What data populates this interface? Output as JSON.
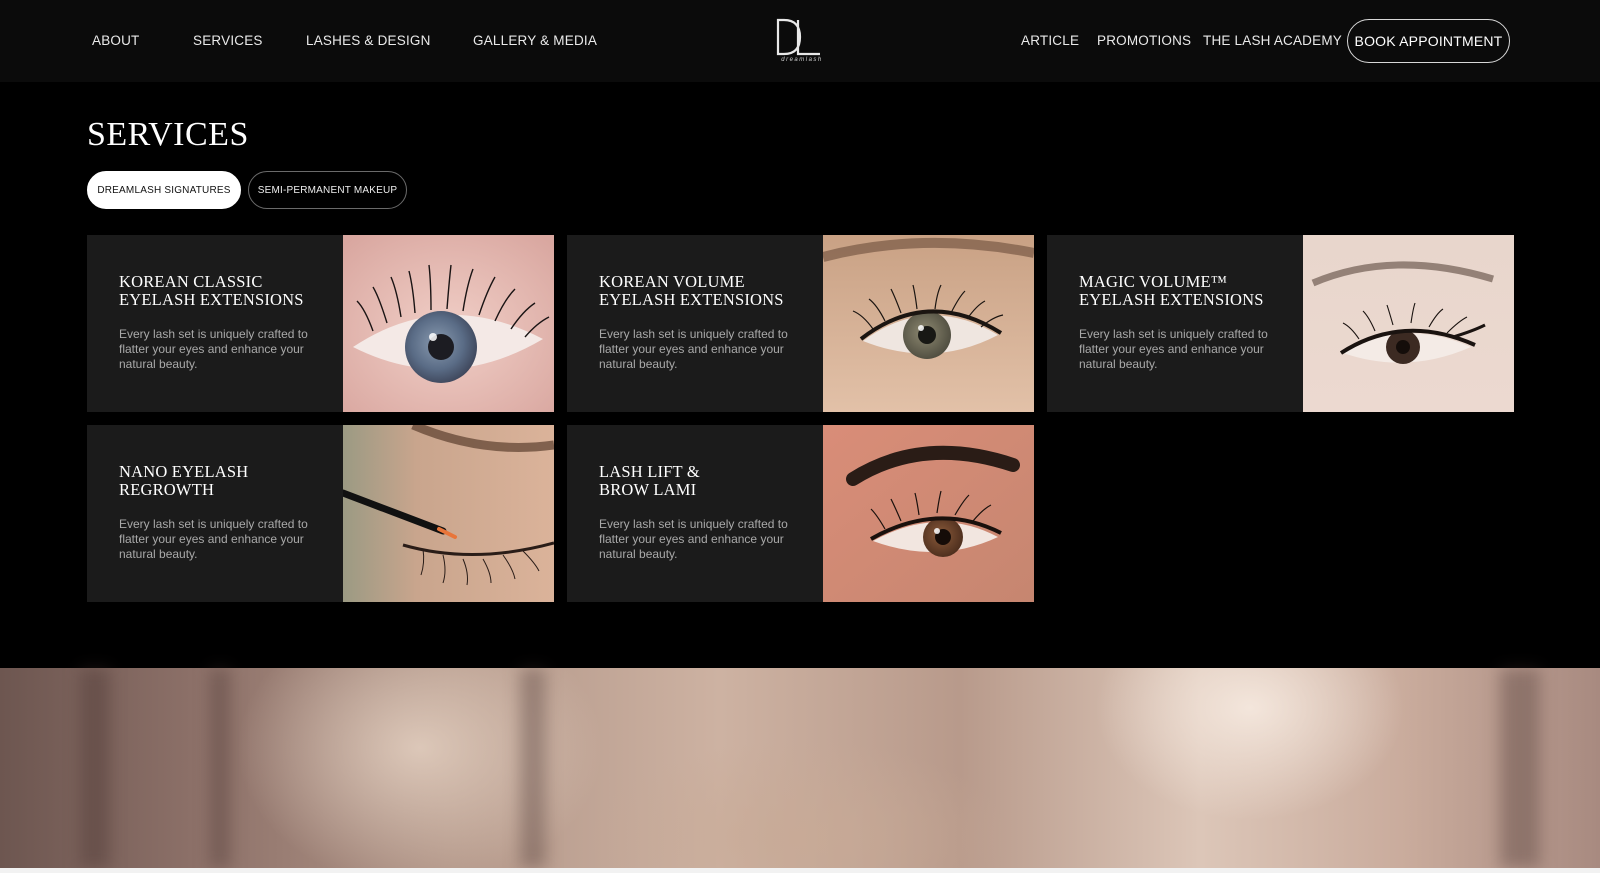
{
  "nav": {
    "left_links": [
      "ABOUT",
      "SERVICES",
      "LASHES & DESIGN",
      "GALLERY & MEDIA"
    ],
    "right_links": [
      "ARTICLE",
      "PROMOTIONS",
      "THE LASH ACADEMY"
    ],
    "logo_mark": "DL",
    "logo_text": "dreamlash",
    "book_label": "BOOK APPOINTMENT"
  },
  "services": {
    "title": "SERVICES",
    "tabs": [
      "DREAMLASH SIGNATURES",
      "SEMI-PERMANENT MAKEUP"
    ],
    "active_tab": "DREAMLASH SIGNATURES",
    "cards": [
      {
        "title": "KOREAN CLASSIC\nEYELASH EXTENSIONS",
        "desc": "Every lash set is uniquely crafted to flatter your eyes and enhance your natural beauty.",
        "image_icon": "eye-closeup-blue-iris"
      },
      {
        "title": "KOREAN VOLUME\nEYELASH EXTENSIONS",
        "desc": "Every lash set is uniquely crafted to flatter your eyes and enhance your natural beauty.",
        "image_icon": "eye-closeup-green-iris"
      },
      {
        "title": "MAGIC VOLUME™\nEYELASH EXTENSIONS",
        "desc": "Every lash set is uniquely crafted to flatter your eyes and enhance your natural beauty.",
        "image_icon": "eye-closeup-dark-iris"
      },
      {
        "title": "NANO EYELASH\nREGROWTH",
        "desc": "Every lash set is uniquely crafted to flatter your eyes and enhance your natural beauty.",
        "image_icon": "serum-applicator-eye"
      },
      {
        "title": "LASH LIFT &\nBROW LAMI",
        "desc": "Every lash set is uniquely crafted to flatter your eyes and enhance your natural beauty.",
        "image_icon": "eye-brow-closeup"
      }
    ]
  },
  "colors": {
    "background": "#000000",
    "nav_bg": "#0b0b0b",
    "card_bg": "#1b1b1b",
    "text_muted": "#a9a9a9"
  }
}
